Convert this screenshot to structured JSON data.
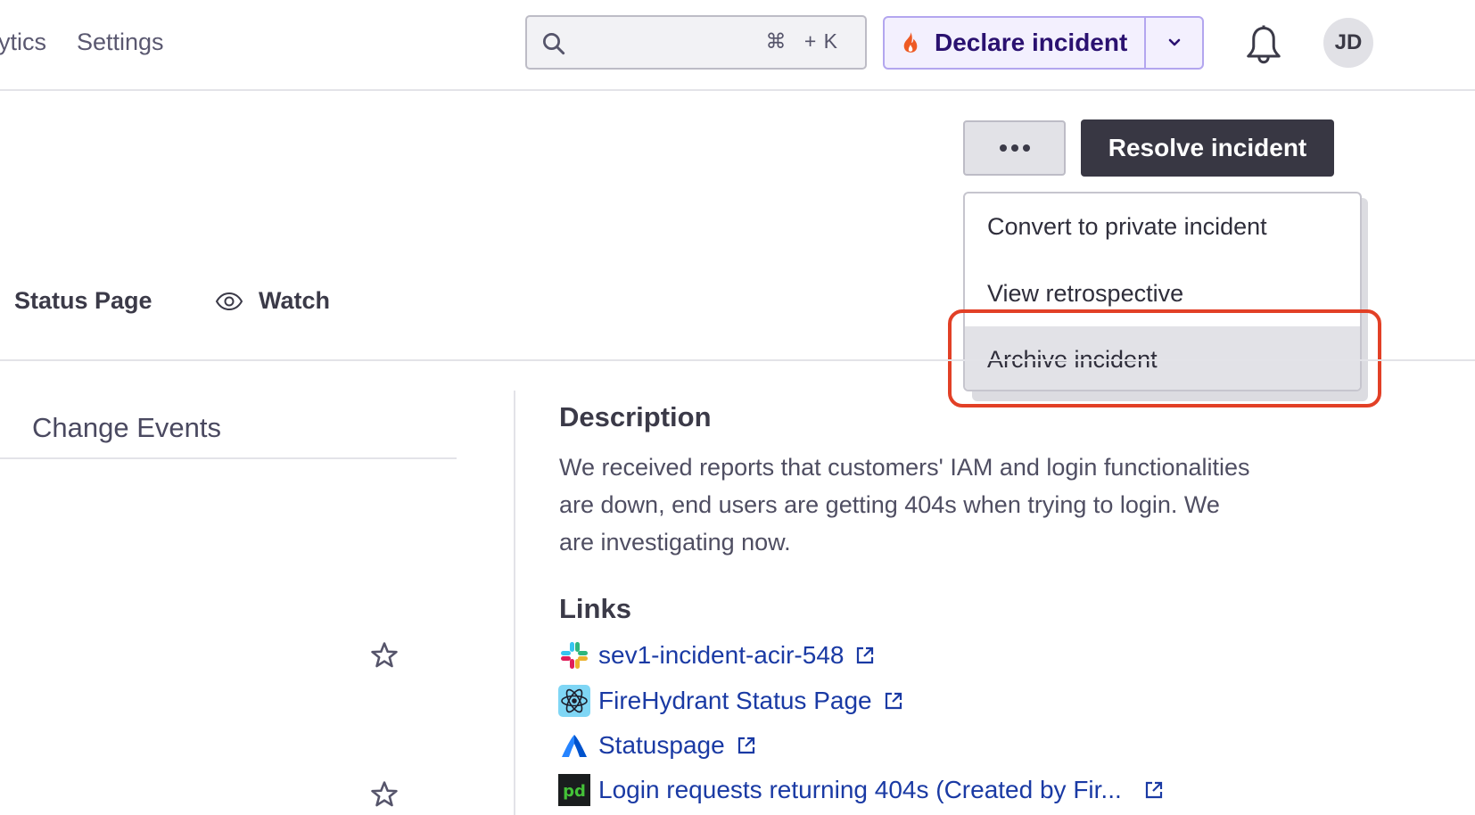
{
  "nav": {
    "items": [
      {
        "label": "ytics"
      },
      {
        "label": "Settings"
      }
    ]
  },
  "search": {
    "placeholder": "",
    "shortcut_symbol": "⌘",
    "shortcut_key": "+ K"
  },
  "declare": {
    "label": "Declare incident",
    "icon": "fire-icon"
  },
  "user": {
    "initials": "JD"
  },
  "actions": {
    "more_label": "More actions",
    "resolve_label": "Resolve incident"
  },
  "menu": {
    "items": [
      {
        "label": "Convert to private incident",
        "highlighted": false
      },
      {
        "label": "View retrospective",
        "highlighted": false
      },
      {
        "label": "Archive incident",
        "highlighted": true
      }
    ]
  },
  "subnav": {
    "status_page": "Status Page",
    "watch": "Watch"
  },
  "left": {
    "tab_label": "Change Events"
  },
  "description": {
    "title": "Description",
    "body": "We received reports that customers' IAM and login functionalities are down, end users are getting 404s when trying to login. We are investigating now."
  },
  "links": {
    "title": "Links",
    "items": [
      {
        "label": "sev1-incident-acir-548",
        "icon": "slack-icon"
      },
      {
        "label": "FireHydrant Status Page",
        "icon": "react-icon"
      },
      {
        "label": "Statuspage",
        "icon": "atlassian-statuspage-icon"
      },
      {
        "label": "Login requests returning 404s (Created by Fir...",
        "icon": "pagerduty-icon"
      }
    ]
  },
  "colors": {
    "accent_highlight": "#e24026",
    "link": "#1a3aa4",
    "declare_bg": "#f3f0fe",
    "declare_text": "#2a1170",
    "primary_button": "#383743"
  }
}
